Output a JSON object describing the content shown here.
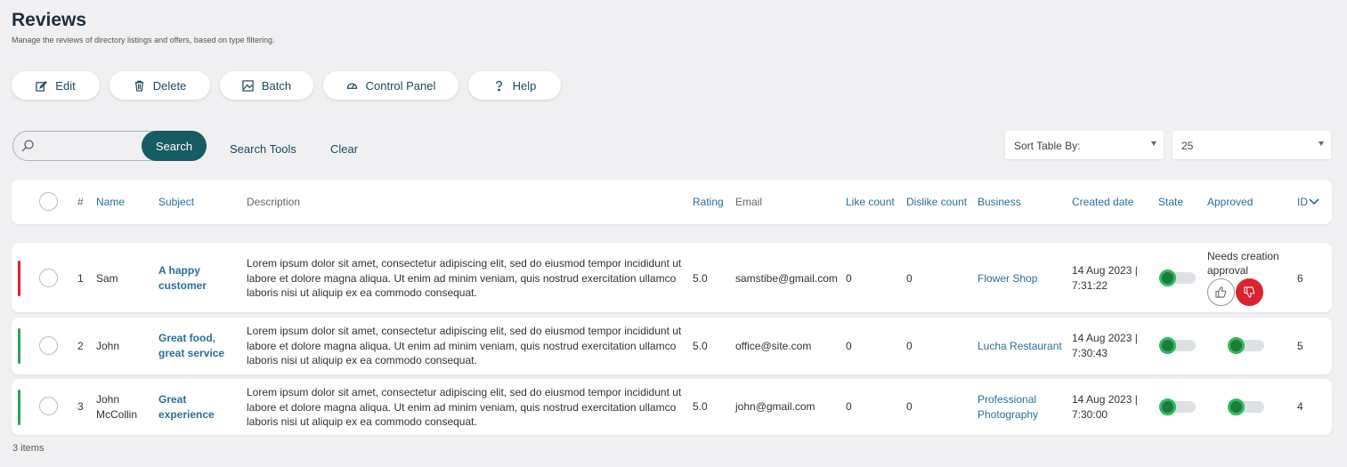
{
  "page": {
    "title": "Reviews",
    "subtitle": "Manage the reviews of directory listings and offers, based on type filtering."
  },
  "toolbar": {
    "edit": "Edit",
    "delete": "Delete",
    "batch": "Batch",
    "control_panel": "Control Panel",
    "help": "Help"
  },
  "search": {
    "value": "",
    "placeholder": "",
    "button": "Search",
    "tools": "Search Tools",
    "clear": "Clear"
  },
  "sort": {
    "label": "Sort Table By:"
  },
  "limit": {
    "value": "25"
  },
  "table": {
    "headers": {
      "num": "#",
      "name": "Name",
      "subject": "Subject",
      "description": "Description",
      "rating": "Rating",
      "email": "Email",
      "like": "Like count",
      "dislike": "Dislike count",
      "business": "Business",
      "created": "Created date",
      "state": "State",
      "approved": "Approved",
      "id": "ID"
    },
    "rows": [
      {
        "num": "1",
        "name": "Sam",
        "subject": "A happy customer",
        "description": "Lorem ipsum dolor sit amet, consectetur adipiscing elit, sed do eiusmod tempor incididunt ut labore et dolore magna aliqua. Ut enim ad minim veniam, quis nostrud exercitation ullamco laboris nisi ut aliquip ex ea commodo consequat.",
        "rating": "5.0",
        "email": "samstibe@gmail.com",
        "likes": "0",
        "dislikes": "0",
        "business": "Flower Shop",
        "created": "14 Aug 2023 | 7:31:22",
        "approved_text": "Needs creation approval",
        "id": "6",
        "status_color": "#d9232f"
      },
      {
        "num": "2",
        "name": "John",
        "subject": "Great food, great service",
        "description": "Lorem ipsum dolor sit amet, consectetur adipiscing elit, sed do eiusmod tempor incididunt ut labore et dolore magna aliqua. Ut enim ad minim veniam, quis nostrud exercitation ullamco laboris nisi ut aliquip ex ea commodo consequat.",
        "rating": "5.0",
        "email": "office@site.com",
        "likes": "0",
        "dislikes": "0",
        "business": "Lucha Restaurant",
        "created": "14 Aug 2023 | 7:30:43",
        "id": "5",
        "status_color": "#2fa45c"
      },
      {
        "num": "3",
        "name": "John McCollin",
        "subject": "Great experience",
        "description": "Lorem ipsum dolor sit amet, consectetur adipiscing elit, sed do eiusmod tempor incididunt ut labore et dolore magna aliqua. Ut enim ad minim veniam, quis nostrud exercitation ullamco laboris nisi ut aliquip ex ea commodo consequat.",
        "rating": "5.0",
        "email": "john@gmail.com",
        "likes": "0",
        "dislikes": "0",
        "business": "Professional Photography",
        "created": "14 Aug 2023 | 7:30:00",
        "id": "4",
        "status_color": "#2fa45c"
      }
    ]
  },
  "footer": {
    "count": "3 items"
  },
  "colors": {
    "accent": "#175b63",
    "link": "#2d6e9a",
    "danger": "#d9232f",
    "success": "#2fba5e"
  }
}
